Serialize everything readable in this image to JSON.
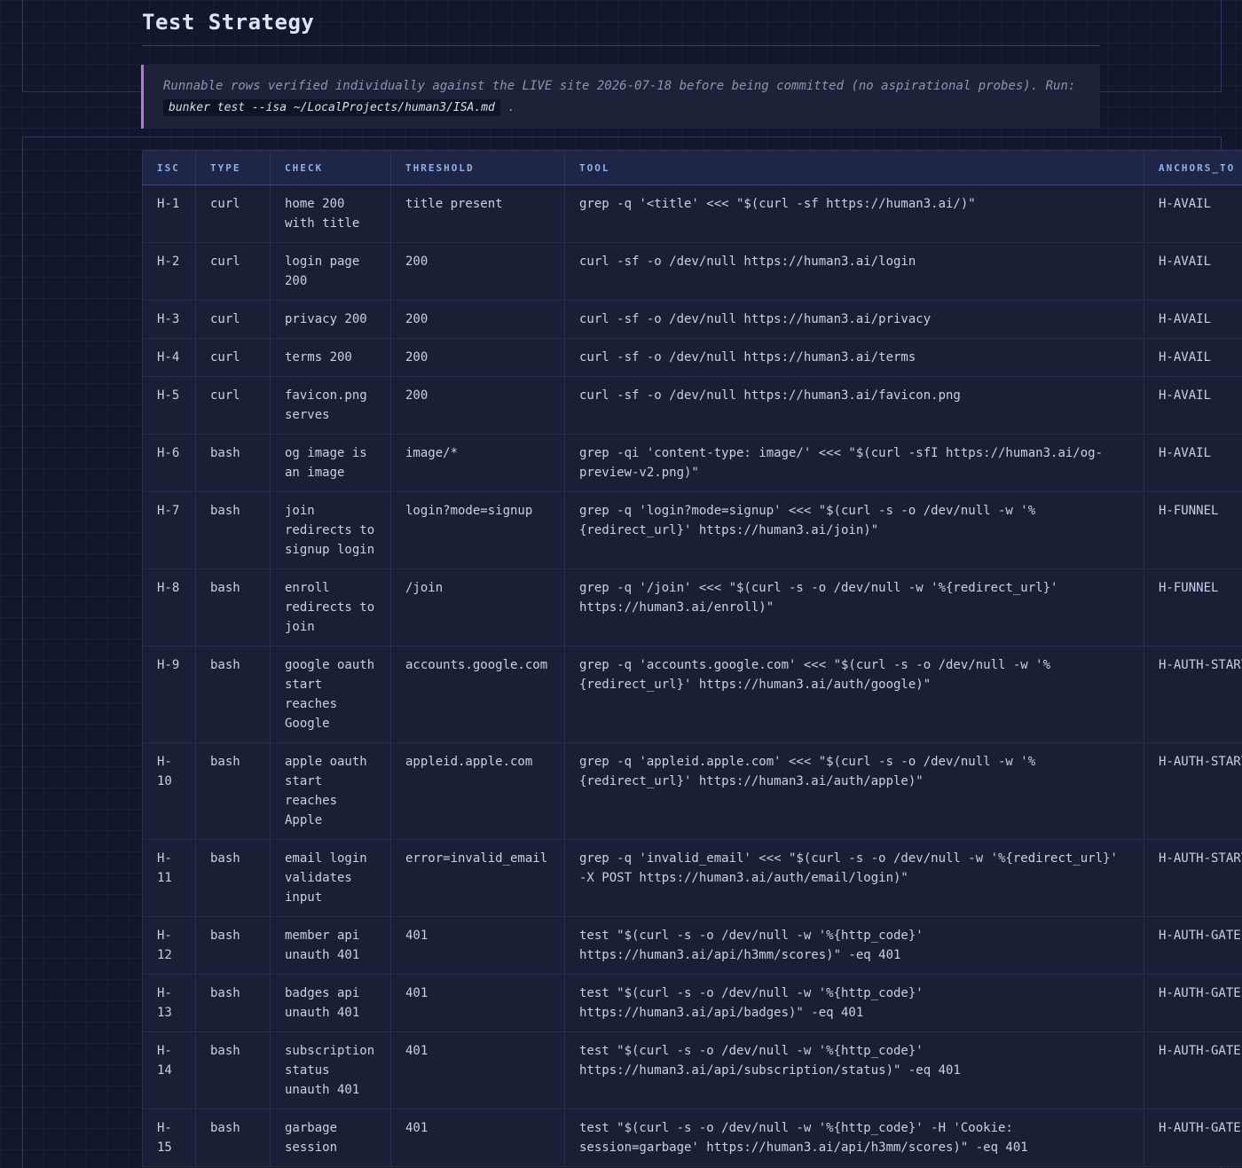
{
  "heading": "Test Strategy",
  "callout": {
    "text_before": "Runnable rows verified individually against the LIVE site 2026-07-18 before being committed (no aspirational probes). Run:",
    "command": "bunker test --isa ~/LocalProjects/human3/ISA.md",
    "text_after": "."
  },
  "table": {
    "columns": [
      "ISC",
      "TYPE",
      "CHECK",
      "THRESHOLD",
      "TOOL",
      "ANCHORS_TO"
    ],
    "rows": [
      {
        "isc": "H-1",
        "type": "curl",
        "check": "home 200 with title",
        "threshold": "title present",
        "tool": "grep -q '<title' <<< \"$(curl -sf https://human3.ai/)\"",
        "anchors": "H-AVAIL"
      },
      {
        "isc": "H-2",
        "type": "curl",
        "check": "login page 200",
        "threshold": "200",
        "tool": "curl -sf -o /dev/null https://human3.ai/login",
        "anchors": "H-AVAIL"
      },
      {
        "isc": "H-3",
        "type": "curl",
        "check": "privacy 200",
        "threshold": "200",
        "tool": "curl -sf -o /dev/null https://human3.ai/privacy",
        "anchors": "H-AVAIL"
      },
      {
        "isc": "H-4",
        "type": "curl",
        "check": "terms 200",
        "threshold": "200",
        "tool": "curl -sf -o /dev/null https://human3.ai/terms",
        "anchors": "H-AVAIL"
      },
      {
        "isc": "H-5",
        "type": "curl",
        "check": "favicon.png serves",
        "threshold": "200",
        "tool": "curl -sf -o /dev/null https://human3.ai/favicon.png",
        "anchors": "H-AVAIL"
      },
      {
        "isc": "H-6",
        "type": "bash",
        "check": "og image is an image",
        "threshold": "image/*",
        "tool": "grep -qi 'content-type: image/' <<< \"$(curl -sfI https://human3.ai/og-preview-v2.png)\"",
        "anchors": "H-AVAIL"
      },
      {
        "isc": "H-7",
        "type": "bash",
        "check": "join redirects to signup login",
        "threshold": "login?mode=signup",
        "tool": "grep -q 'login?mode=signup' <<< \"$(curl -s -o /dev/null -w '%{redirect_url}' https://human3.ai/join)\"",
        "anchors": "H-FUNNEL"
      },
      {
        "isc": "H-8",
        "type": "bash",
        "check": "enroll redirects to join",
        "threshold": "/join",
        "tool": "grep -q '/join' <<< \"$(curl -s -o /dev/null -w '%{redirect_url}' https://human3.ai/enroll)\"",
        "anchors": "H-FUNNEL"
      },
      {
        "isc": "H-9",
        "type": "bash",
        "check": "google oauth start reaches Google",
        "threshold": "accounts.google.com",
        "tool": "grep -q 'accounts.google.com' <<< \"$(curl -s -o /dev/null -w '%{redirect_url}' https://human3.ai/auth/google)\"",
        "anchors": "H-AUTH-START"
      },
      {
        "isc": "H-10",
        "type": "bash",
        "check": "apple oauth start reaches Apple",
        "threshold": "appleid.apple.com",
        "tool": "grep -q 'appleid.apple.com' <<< \"$(curl -s -o /dev/null -w '%{redirect_url}' https://human3.ai/auth/apple)\"",
        "anchors": "H-AUTH-START"
      },
      {
        "isc": "H-11",
        "type": "bash",
        "check": "email login validates input",
        "threshold": "error=invalid_email",
        "tool": "grep -q 'invalid_email' <<< \"$(curl -s -o /dev/null -w '%{redirect_url}' -X POST https://human3.ai/auth/email/login)\"",
        "anchors": "H-AUTH-START"
      },
      {
        "isc": "H-12",
        "type": "bash",
        "check": "member api unauth 401",
        "threshold": "401",
        "tool": "test \"$(curl -s -o /dev/null -w '%{http_code}' https://human3.ai/api/h3mm/scores)\" -eq 401",
        "anchors": "H-AUTH-GATE"
      },
      {
        "isc": "H-13",
        "type": "bash",
        "check": "badges api unauth 401",
        "threshold": "401",
        "tool": "test \"$(curl -s -o /dev/null -w '%{http_code}' https://human3.ai/api/badges)\" -eq 401",
        "anchors": "H-AUTH-GATE"
      },
      {
        "isc": "H-14",
        "type": "bash",
        "check": "subscription status unauth 401",
        "threshold": "401",
        "tool": "test \"$(curl -s -o /dev/null -w '%{http_code}' https://human3.ai/api/subscription/status)\" -eq 401",
        "anchors": "H-AUTH-GATE"
      },
      {
        "isc": "H-15",
        "type": "bash",
        "check": "garbage session",
        "threshold": "401",
        "tool": "test \"$(curl -s -o /dev/null -w '%{http_code}' -H 'Cookie: session=garbage' https://human3.ai/api/h3mm/scores)\" -eq 401",
        "anchors": "H-AUTH-GATE"
      }
    ]
  }
}
